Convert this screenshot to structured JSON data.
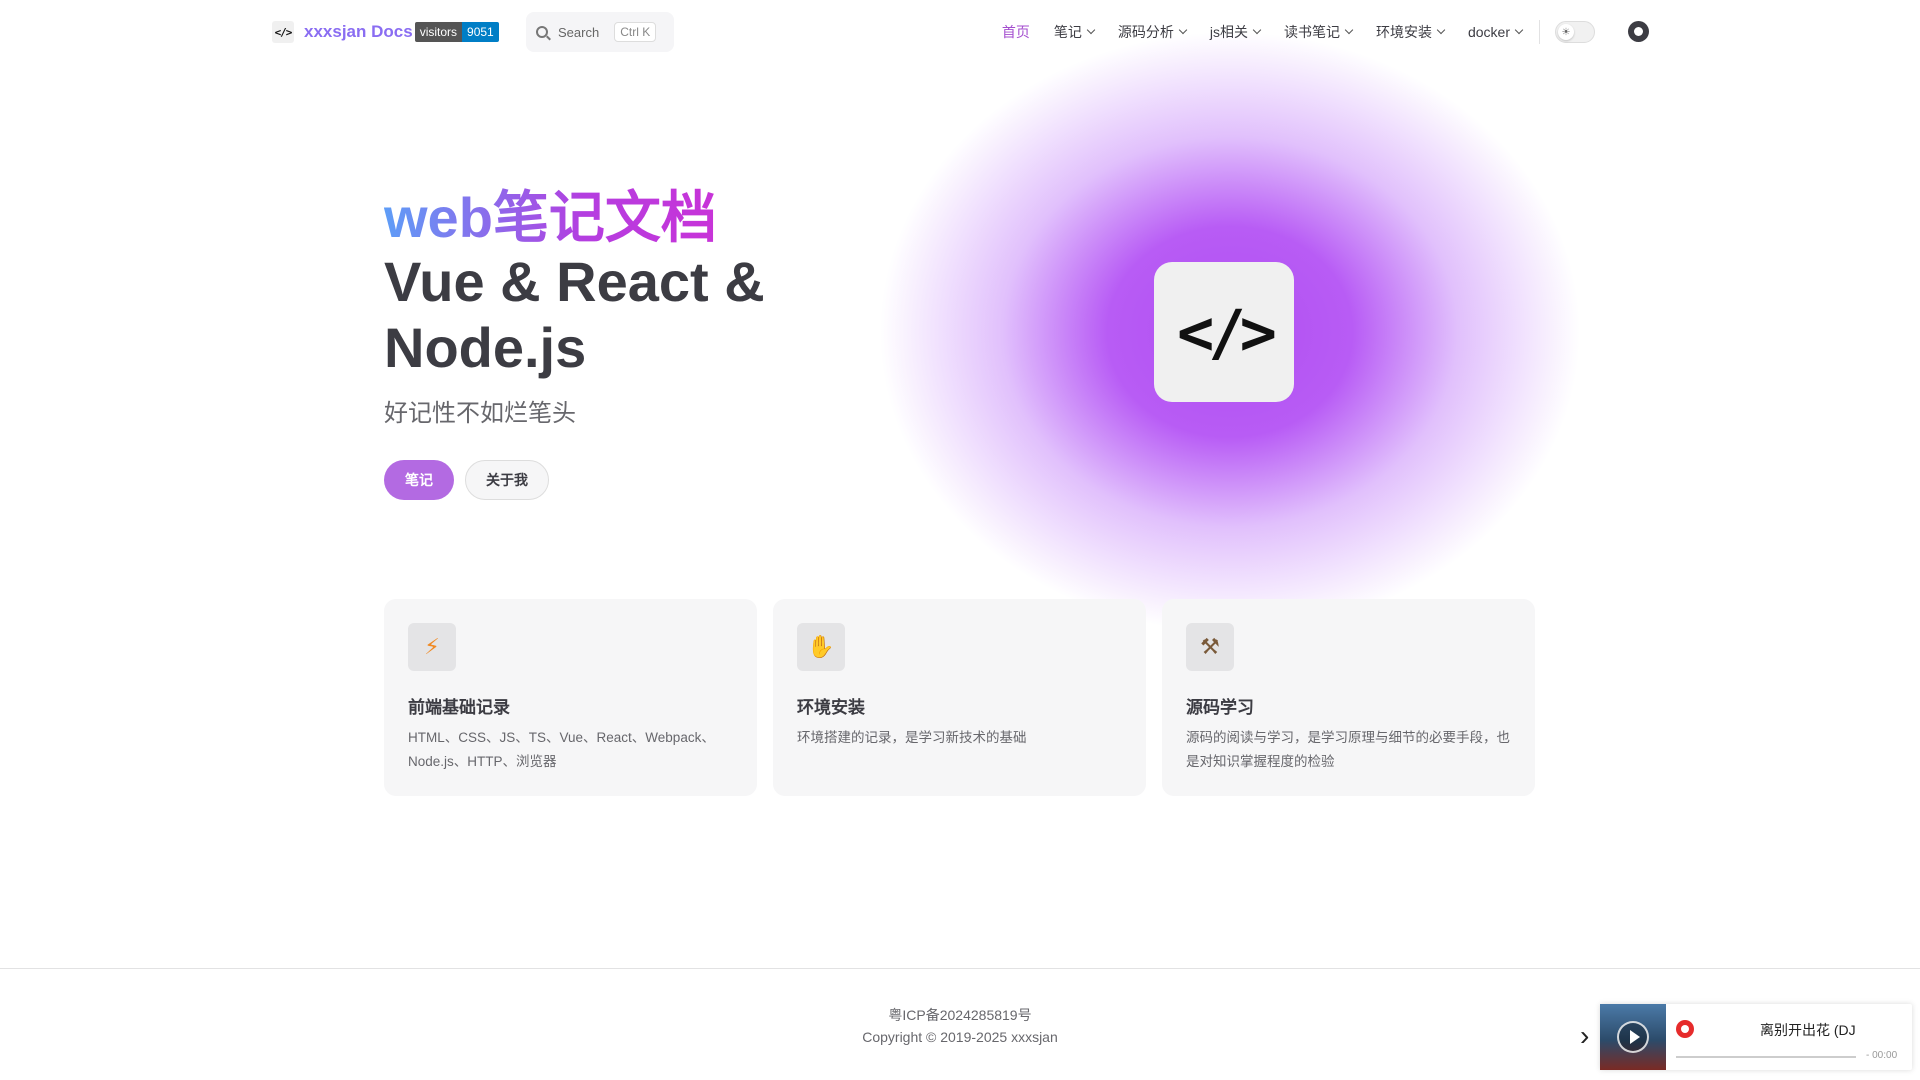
{
  "brand": {
    "logo_text": "</>",
    "name": "xxxsjan Docs",
    "visitors_label": "visitors",
    "visitors_count": "9051"
  },
  "search": {
    "placeholder": "Search",
    "shortcut": "Ctrl K"
  },
  "nav": {
    "items": [
      {
        "label": "首页",
        "active": true,
        "dropdown": false
      },
      {
        "label": "笔记",
        "active": false,
        "dropdown": true
      },
      {
        "label": "源码分析",
        "active": false,
        "dropdown": true
      },
      {
        "label": "js相关",
        "active": false,
        "dropdown": true
      },
      {
        "label": "读书笔记",
        "active": false,
        "dropdown": true
      },
      {
        "label": "环境安装",
        "active": false,
        "dropdown": true
      },
      {
        "label": "docker",
        "active": false,
        "dropdown": true
      }
    ],
    "theme_icon": "sun-icon",
    "github_icon": "github-icon"
  },
  "hero": {
    "name": "web笔记文档",
    "text_line1": "Vue & React &",
    "text_line2": "Node.js",
    "tagline": "好记性不如烂笔头",
    "actions": [
      {
        "label": "笔记"
      },
      {
        "label": "关于我"
      }
    ],
    "logo_text": "</>"
  },
  "features": [
    {
      "icon": "lightning-icon",
      "glyph": "⚡",
      "title": "前端基础记录",
      "desc": "HTML、CSS、JS、TS、Vue、React、Webpack、Node.js、HTTP、浏览器"
    },
    {
      "icon": "hand-icon",
      "glyph": "🖖",
      "title": "环境安装",
      "desc": "环境搭建的记录，是学习新技术的基础"
    },
    {
      "icon": "tools-icon",
      "glyph": "🛠",
      "title": "源码学习",
      "desc": "源码的阅读与学习，是学习原理与细节的必要手段，也是对知识掌握程度的检验"
    }
  ],
  "footer": {
    "icp": "粤ICP备2024285819号",
    "copyright": "Copyright © 2019-2025 xxxsjan"
  },
  "player": {
    "song": "离别开出花 (DJ",
    "time": "- 00:00"
  },
  "colors": {
    "accent": "#a44ecf",
    "button": "#b36ae2",
    "brand": "#8a6df2"
  }
}
